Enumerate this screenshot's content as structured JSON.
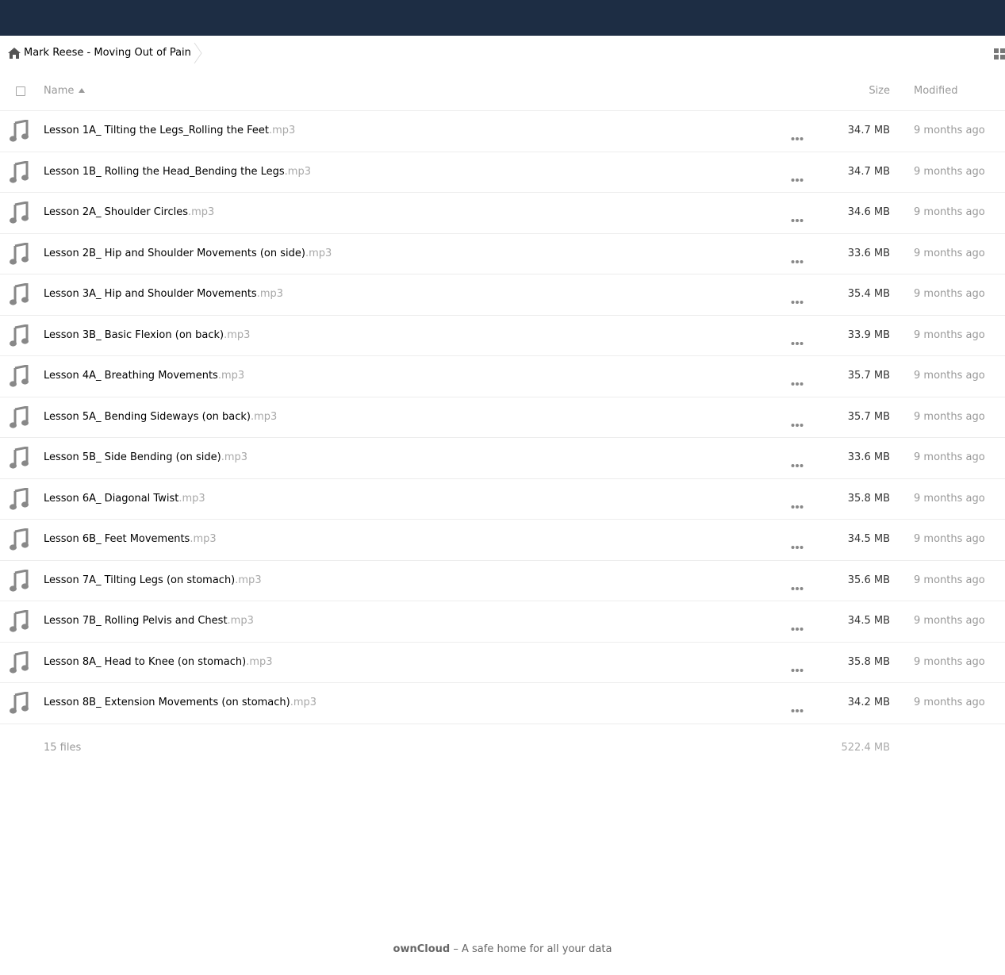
{
  "breadcrumb": {
    "folder": "Mark Reese - Moving Out of Pain"
  },
  "table_header": {
    "name": "Name",
    "size": "Size",
    "modified": "Modified"
  },
  "files": [
    {
      "name": "Lesson 1A_ Tilting the Legs_Rolling the Feet",
      "ext": ".mp3",
      "size": "34.7 MB",
      "modified": "9 months ago"
    },
    {
      "name": "Lesson 1B_ Rolling the Head_Bending the Legs",
      "ext": ".mp3",
      "size": "34.7 MB",
      "modified": "9 months ago"
    },
    {
      "name": "Lesson 2A_ Shoulder Circles",
      "ext": ".mp3",
      "size": "34.6 MB",
      "modified": "9 months ago"
    },
    {
      "name": "Lesson 2B_ Hip and Shoulder Movements (on side)",
      "ext": ".mp3",
      "size": "33.6 MB",
      "modified": "9 months ago"
    },
    {
      "name": "Lesson 3A_ Hip and Shoulder Movements",
      "ext": ".mp3",
      "size": "35.4 MB",
      "modified": "9 months ago"
    },
    {
      "name": "Lesson 3B_ Basic Flexion (on back)",
      "ext": ".mp3",
      "size": "33.9 MB",
      "modified": "9 months ago"
    },
    {
      "name": "Lesson 4A_ Breathing Movements",
      "ext": ".mp3",
      "size": "35.7 MB",
      "modified": "9 months ago"
    },
    {
      "name": "Lesson 5A_ Bending Sideways (on back)",
      "ext": ".mp3",
      "size": "35.7 MB",
      "modified": "9 months ago"
    },
    {
      "name": "Lesson 5B_ Side Bending (on side)",
      "ext": ".mp3",
      "size": "33.6 MB",
      "modified": "9 months ago"
    },
    {
      "name": "Lesson 6A_ Diagonal Twist",
      "ext": ".mp3",
      "size": "35.8 MB",
      "modified": "9 months ago"
    },
    {
      "name": "Lesson 6B_ Feet Movements",
      "ext": ".mp3",
      "size": "34.5 MB",
      "modified": "9 months ago"
    },
    {
      "name": "Lesson 7A_ Tilting Legs (on stomach)",
      "ext": ".mp3",
      "size": "35.6 MB",
      "modified": "9 months ago"
    },
    {
      "name": "Lesson 7B_ Rolling Pelvis and Chest",
      "ext": ".mp3",
      "size": "34.5 MB",
      "modified": "9 months ago"
    },
    {
      "name": "Lesson 8A_ Head to Knee (on stomach)",
      "ext": ".mp3",
      "size": "35.8 MB",
      "modified": "9 months ago"
    },
    {
      "name": "Lesson 8B_ Extension Movements (on stomach)",
      "ext": ".mp3",
      "size": "34.2 MB",
      "modified": "9 months ago"
    }
  ],
  "summary": {
    "count": "15 files",
    "total_size": "522.4 MB"
  },
  "footer": {
    "brand": "ownCloud",
    "tagline": " – A safe home for all your data"
  },
  "icons": {
    "home": "home-icon",
    "file": "music-note-icon",
    "menu": "more-dots-icon",
    "view": "grid-view-icon",
    "sort": "sort-ascending-icon"
  },
  "colors": {
    "header_bg": "#1d2d44",
    "icon_gray": "#888888",
    "extension_gray": "#a8a8a8"
  }
}
